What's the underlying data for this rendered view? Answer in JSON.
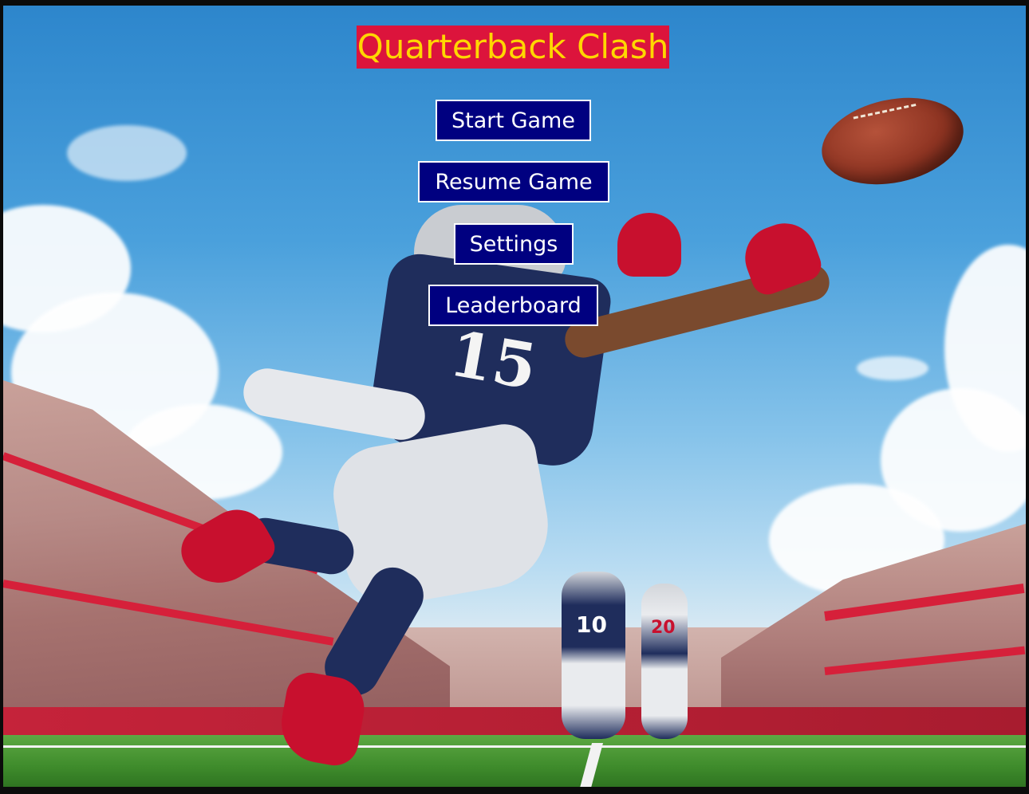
{
  "game": {
    "title": "Quarterback Clash"
  },
  "menu": {
    "start_label": "Start Game",
    "resume_label": "Resume Game",
    "settings_label": "Settings",
    "leaderboard_label": "Leaderboard"
  },
  "colors": {
    "title_background": "#dc143c",
    "title_text": "#ffd700",
    "button_background": "#000080",
    "button_text": "#ffffff",
    "button_border": "#ffffff"
  },
  "scene": {
    "background": "football-stadium-illustration",
    "player_number": "15",
    "background_player_numbers": [
      "10",
      "20"
    ]
  }
}
